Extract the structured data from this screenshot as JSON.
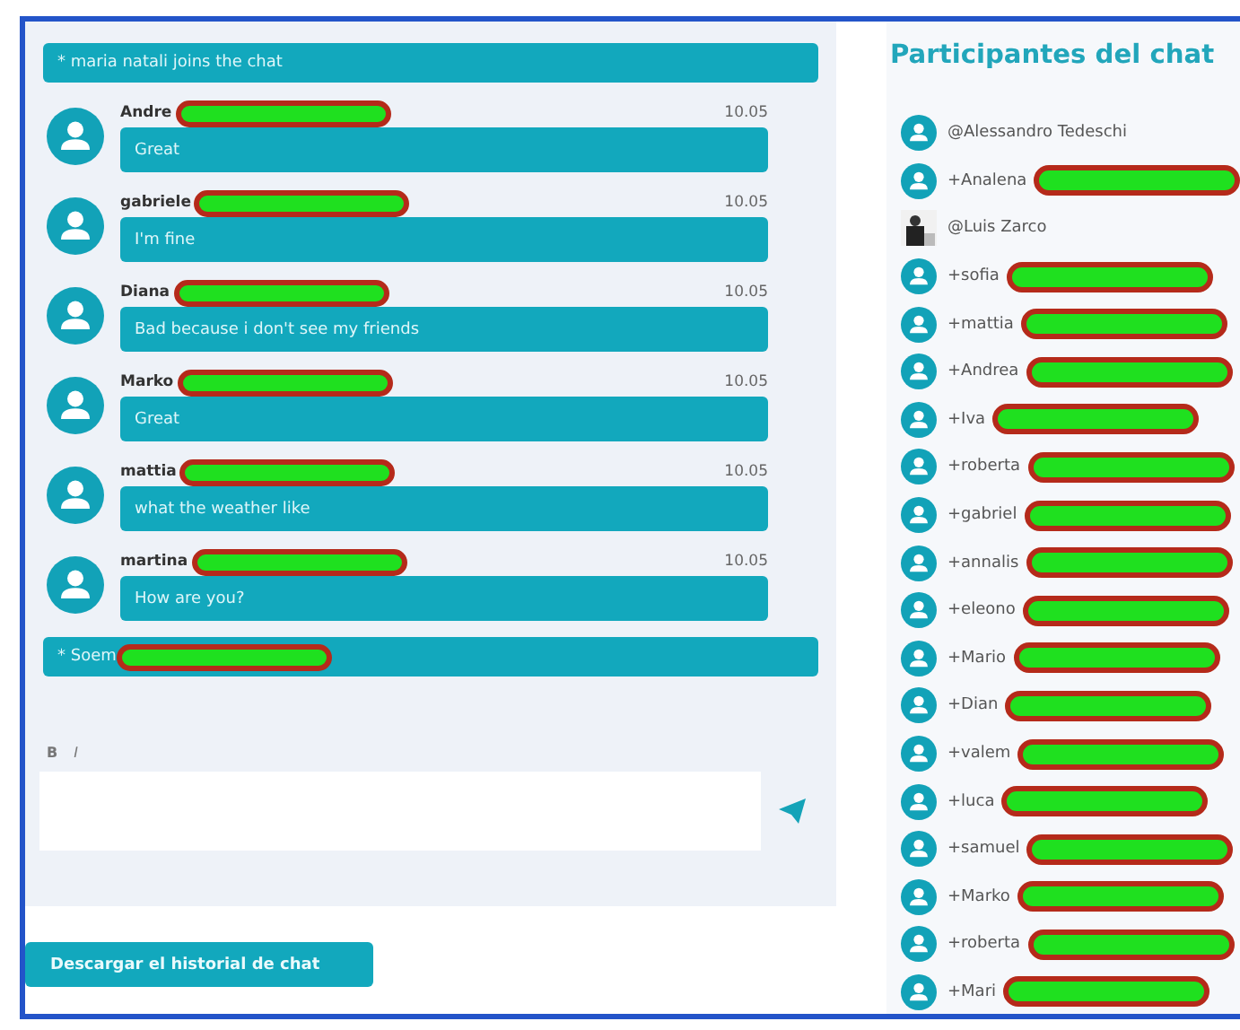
{
  "chat": {
    "events": [
      {
        "kind": "system",
        "text": "* maria natali joins the chat",
        "redacted": false
      },
      {
        "kind": "message",
        "author": "Andre",
        "time": "10.05",
        "text": "Great",
        "redacted": true
      },
      {
        "kind": "message",
        "author": "gabriele",
        "time": "10.05",
        "text": "I'm fine",
        "redacted": true
      },
      {
        "kind": "message",
        "author": "Diana",
        "time": "10.05",
        "text": "Bad because i don't see my friends",
        "redacted": true
      },
      {
        "kind": "message",
        "author": "Marko",
        "time": "10.05",
        "text": "Great",
        "redacted": true
      },
      {
        "kind": "message",
        "author": "mattia",
        "time": "10.05",
        "text": "what the weather like",
        "redacted": true
      },
      {
        "kind": "message",
        "author": "martina",
        "time": "10.05",
        "text": "How are you?",
        "redacted": true
      },
      {
        "kind": "system",
        "text": "* Soem",
        "redacted": true
      }
    ],
    "format_buttons": [
      "B",
      "I"
    ],
    "download_button": "Descargar el historial de chat"
  },
  "participants": {
    "title": "Participantes del chat",
    "items": [
      {
        "name": "@Alessandro Tedeschi",
        "kind": "default",
        "redacted": false
      },
      {
        "name": "+Analena",
        "kind": "default",
        "redacted": true
      },
      {
        "name": "@Luis Zarco",
        "redacted": false
      },
      {
        "name": "+sofia",
        "kind": "default",
        "redacted": true
      },
      {
        "name": "+mattia",
        "kind": "default",
        "redacted": true
      },
      {
        "name": "+Andrea",
        "kind": "default",
        "redacted": true
      },
      {
        "name": "+Iva",
        "kind": "default",
        "redacted": true
      },
      {
        "name": "+roberta",
        "kind": "default",
        "redacted": true
      },
      {
        "name": "+gabriel",
        "kind": "default",
        "redacted": true
      },
      {
        "name": "+annalis",
        "kind": "default",
        "redacted": true
      },
      {
        "name": "+eleono",
        "kind": "default",
        "redacted": true
      },
      {
        "name": "+Mario",
        "kind": "default",
        "redacted": true
      },
      {
        "name": "+Dian",
        "kind": "default",
        "redacted": true
      },
      {
        "name": "+valem",
        "kind": "default",
        "redacted": true
      },
      {
        "name": "+luca",
        "kind": "default",
        "redacted": true
      },
      {
        "name": "+samuel",
        "kind": "default",
        "redacted": true
      },
      {
        "name": "+Marko",
        "kind": "default",
        "redacted": true
      },
      {
        "name": "+roberta",
        "kind": "default",
        "redacted": true
      },
      {
        "name": "+Mari",
        "kind": "default",
        "redacted": true
      }
    ]
  }
}
